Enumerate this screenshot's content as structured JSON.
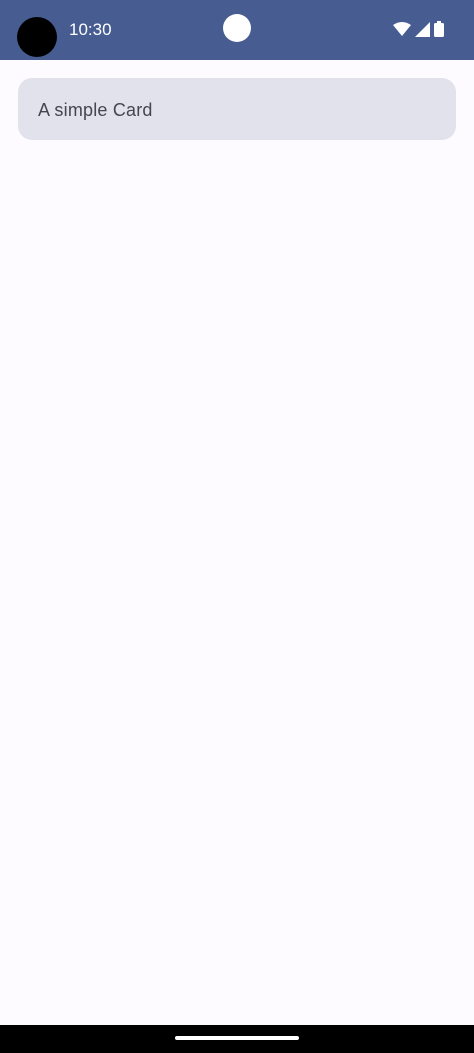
{
  "status_bar": {
    "time": "10:30",
    "background_color": "#475d92",
    "icons": [
      "wifi-icon",
      "cellular-signal-icon",
      "battery-icon"
    ]
  },
  "card": {
    "text": "A simple Card",
    "background_color": "#e1e2ec"
  },
  "page": {
    "background_color": "#fdfbff"
  }
}
